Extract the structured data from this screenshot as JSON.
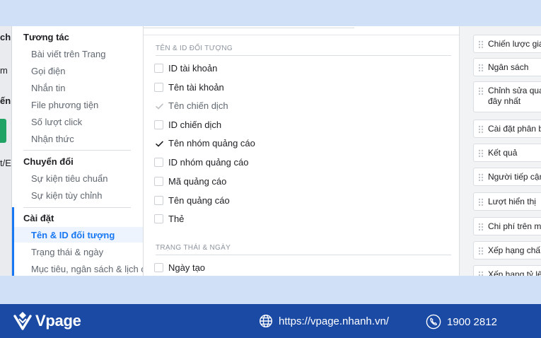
{
  "left_strip": {
    "fragment_1": "ch",
    "fragment_2": "m",
    "fragment_3": "ến",
    "fragment_4": "t/E"
  },
  "sidebar": {
    "groups": [
      {
        "heading": "Tương tác",
        "items": [
          "Bài viết trên Trang",
          "Gọi điện",
          "Nhắn tin",
          "File phương tiện",
          "Số lượt click",
          "Nhận thức"
        ]
      },
      {
        "heading": "Chuyển đổi",
        "items": [
          "Sự kiện tiêu chuẩn",
          "Sự kiện tùy chỉnh"
        ]
      },
      {
        "heading": "Cài đặt",
        "items": [
          "Tên & ID đối tượng",
          "Trạng thái & ngày",
          "Mục tiêu, ngân sách & lịch c"
        ]
      }
    ],
    "active_item": "Tên & ID đối tượng"
  },
  "sections": [
    {
      "title": "TÊN & ID ĐỐI TƯỢNG",
      "options": [
        {
          "label": "ID tài khoản",
          "state": "unchecked"
        },
        {
          "label": "Tên tài khoản",
          "state": "unchecked"
        },
        {
          "label": "Tên chiến dịch",
          "state": "checked-disabled"
        },
        {
          "label": "ID chiến dịch",
          "state": "unchecked"
        },
        {
          "label": "Tên nhóm quảng cáo",
          "state": "checked"
        },
        {
          "label": "ID nhóm quảng cáo",
          "state": "unchecked"
        },
        {
          "label": "Mã quảng cáo",
          "state": "unchecked"
        },
        {
          "label": "Tên quảng cáo",
          "state": "unchecked"
        },
        {
          "label": "Thẻ",
          "state": "unchecked"
        }
      ]
    },
    {
      "title": "TRẠNG THÁI & NGÀY",
      "options": [
        {
          "label": "Ngày tạo",
          "state": "unchecked"
        }
      ]
    }
  ],
  "selected_columns": [
    "Chiến lược giá",
    "Ngân sách",
    [
      "Chỉnh sửa qua",
      "đây nhất"
    ],
    "Cài đặt phân b",
    "Kết quả",
    "Người tiếp cận",
    "Lượt hiển thị",
    "Chi phí trên m",
    "Xếp hạng chấ",
    "Xếp hạng tỷ lệ"
  ],
  "footer": {
    "brand": "Vpage",
    "website": "https://vpage.nhanh.vn/",
    "phone": "1900 2812"
  },
  "colors": {
    "accent": "#1877f2",
    "footer_bg": "#1b4aa4",
    "page_bg": "#cfe0f7"
  }
}
